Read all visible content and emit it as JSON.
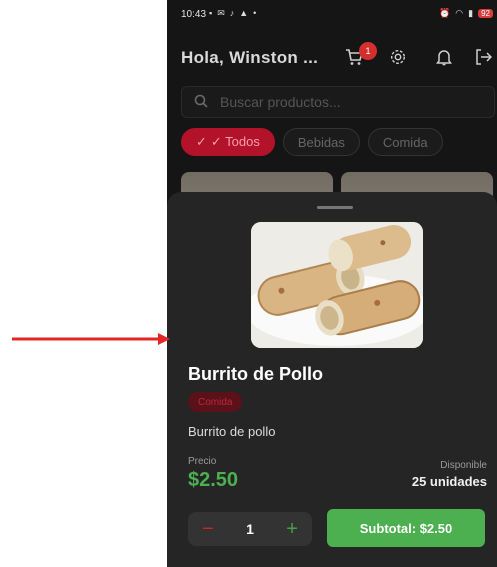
{
  "status_bar": {
    "time": "10:43",
    "battery": "92"
  },
  "header": {
    "greeting": "Hola, Winston ...",
    "cart_count": "1"
  },
  "search": {
    "placeholder": "Buscar productos..."
  },
  "filters": [
    {
      "label": "✓ Todos",
      "active": true
    },
    {
      "label": "Bebidas",
      "active": false
    },
    {
      "label": "Comida",
      "active": false
    }
  ],
  "product": {
    "name": "Burrito de Pollo",
    "category": "Comida",
    "description": "Burrito de pollo",
    "price_label": "Precio",
    "price": "$2.50",
    "stock_label": "Disponible",
    "stock": "25 unidades",
    "quantity": "1",
    "subtotal_button": "Subtotal: $2.50"
  },
  "colors": {
    "accent_red": "#b3122b",
    "price_green": "#4caf50",
    "sheet_bg": "#252525",
    "app_bg": "#151515",
    "annotation_arrow": "#e32626"
  },
  "icons": [
    "cart-icon",
    "gear-icon",
    "bell-icon",
    "logout-icon",
    "search-icon",
    "minus-icon",
    "plus-icon",
    "annotation-arrow-icon"
  ]
}
